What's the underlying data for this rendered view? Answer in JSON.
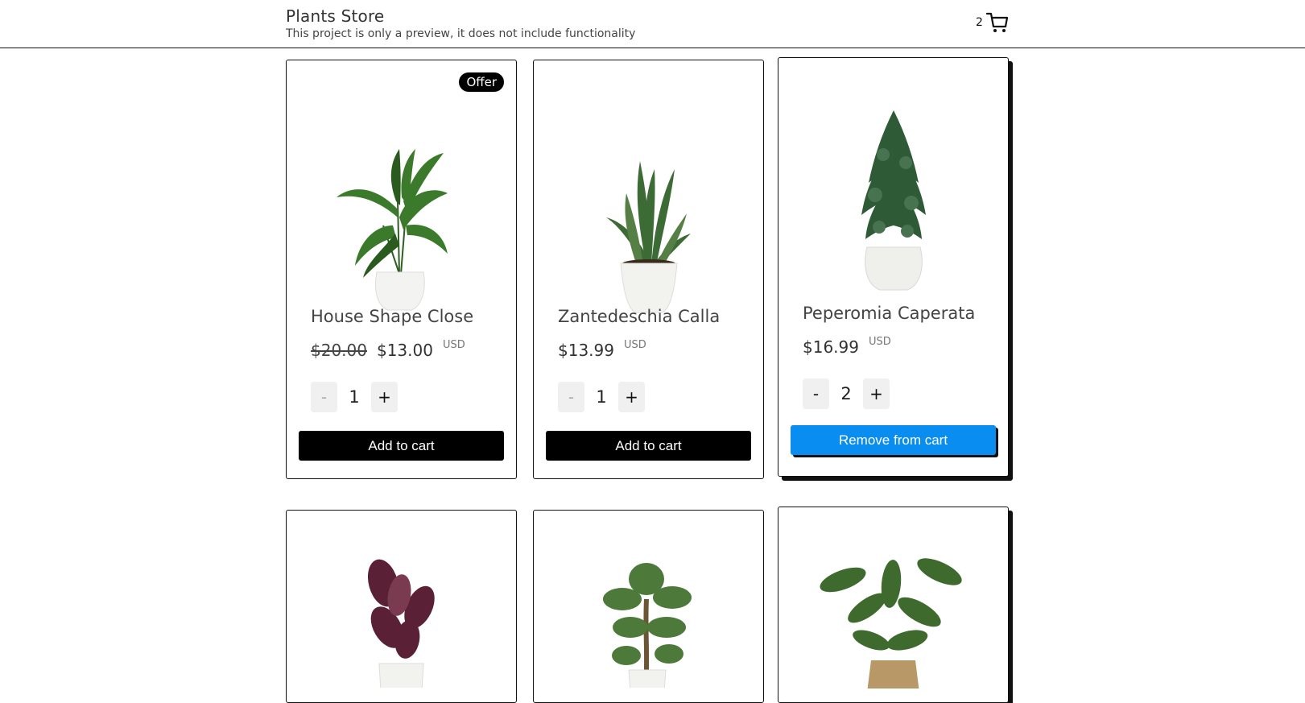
{
  "header": {
    "title": "Plants Store",
    "subtitle": "This project is only a preview, it does not include functionality",
    "cart_count": "2",
    "cart_icon": "shopping-cart-icon"
  },
  "products": [
    {
      "name": "House Shape Close",
      "old_price": "$20.00",
      "price": "$13.00",
      "currency": "USD",
      "qty": "1",
      "badge": "Offer",
      "action": "Add to cart",
      "minus": "-",
      "plus": "+"
    },
    {
      "name": "Zantedeschia Calla",
      "price": "$13.99",
      "currency": "USD",
      "qty": "1",
      "action": "Add to cart",
      "minus": "-",
      "plus": "+"
    },
    {
      "name": "Peperomia Caperata",
      "price": "$16.99",
      "currency": "USD",
      "qty": "2",
      "action": "Remove from cart",
      "minus": "-",
      "plus": "+"
    },
    {
      "image": "calathea-plant-image"
    },
    {
      "image": "araucaria-plant-image"
    },
    {
      "image": "calathea-burlap-plant-image"
    }
  ]
}
